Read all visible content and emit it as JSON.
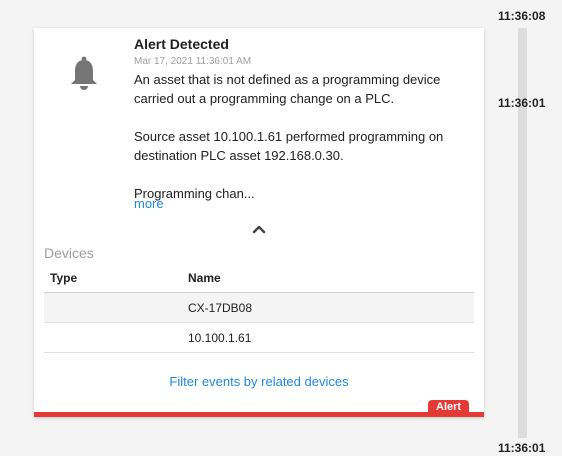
{
  "timeline": {
    "timestamps": [
      "11:36:08",
      "11:36:01",
      "11:36:01"
    ]
  },
  "event": {
    "title": "Alert Detected",
    "date": "Mar 17, 2021 11:36:01 AM",
    "message": "An asset that is not defined as a programming device carried out a programming change on a PLC.\n\nSource asset 10.100.1.61 performed programming on destination PLC asset 192.168.0.30.\n\nProgramming chan...",
    "more_label": "more",
    "badge": "Alert",
    "icon": "bell-icon",
    "accent_color": "#e53935"
  },
  "devices": {
    "title": "Devices",
    "columns": [
      "Type",
      "Name"
    ],
    "rows": [
      {
        "type": "",
        "name": "CX-17DB08"
      },
      {
        "type": "",
        "name": "10.100.1.61"
      }
    ],
    "filter_label": "Filter events by related devices"
  }
}
